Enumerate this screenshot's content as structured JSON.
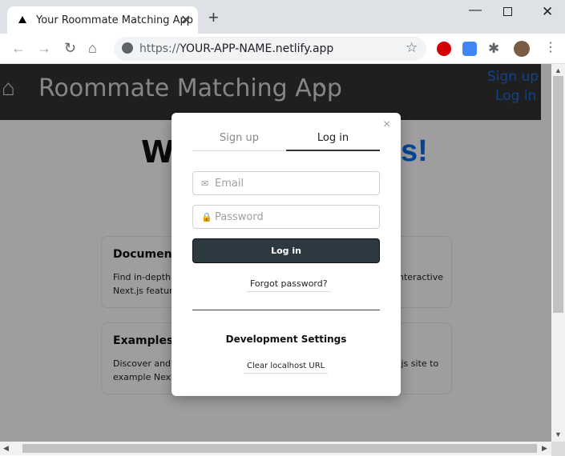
{
  "browser": {
    "tab_title": "Your Roommate Matching App",
    "tab_close": "✕",
    "new_tab": "+",
    "url_scheme": "https://",
    "url_host": "YOUR-APP-NAME.netlify.app"
  },
  "icons": {
    "back": "←",
    "forward": "→",
    "reload": "↻",
    "home": "⌂",
    "star": "☆",
    "puzzle": "✱",
    "menu": "⋮",
    "minimize": "—",
    "close": "✕"
  },
  "app": {
    "title": "Roommate Matching App",
    "house_icon": "⌂",
    "nav_signup": "Sign up",
    "nav_login": "Log in",
    "welcome_start": "We",
    "welcome_end": "s!"
  },
  "cards": [
    {
      "title": "Documenta",
      "text_left": "Find in-depth i",
      "text_right": "nteractive",
      "text_left2": "Next.js feature"
    },
    {
      "title": "Examples –",
      "text_left": "Discover and c",
      "text_right": ".js site to",
      "text_left2": "example Next."
    }
  ],
  "modal": {
    "close": "×",
    "tab_signup": "Sign up",
    "tab_login": "Log in",
    "email_placeholder": "Email",
    "password_placeholder": "Password",
    "submit_label": "Log in",
    "forgot_label": "Forgot password?",
    "dev_title": "Development Settings",
    "clear_label": "Clear localhost URL"
  },
  "colors": {
    "header_bg": "#333333",
    "link_blue": "#1e6dd8",
    "submit_bg": "#2d3941"
  }
}
